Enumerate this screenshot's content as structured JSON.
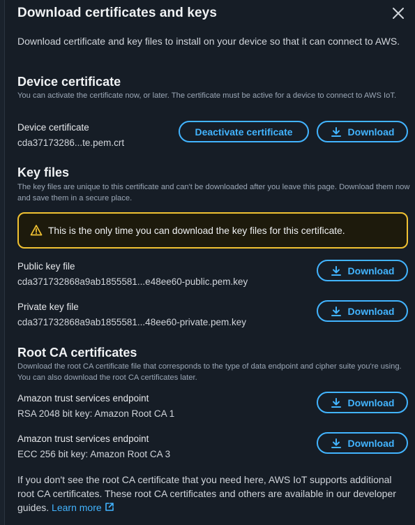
{
  "modal": {
    "title": "Download certificates and keys",
    "close_icon": "close-icon",
    "intro": "Download certificate and key files to install on your device so that it can connect to AWS."
  },
  "device_certificate": {
    "title": "Device certificate",
    "description": "You can activate the certificate now, or later. The certificate must be active for a device to connect to AWS IoT.",
    "label": "Device certificate",
    "value": "cda37173286...te.pem.crt",
    "deactivate_label": "Deactivate certificate",
    "download_label": "Download"
  },
  "key_files": {
    "title": "Key files",
    "description": "The key files are unique to this certificate and can't be downloaded after you leave this page. Download them now and save them in a secure place.",
    "alert": "This is the only time you can download the key files for this certificate.",
    "alert_icon": "warning-icon",
    "public_label": "Public key file",
    "public_value": "cda371732868a9ab1855581...e48ee60-public.pem.key",
    "private_label": "Private key file",
    "private_value": "cda371732868a9ab1855581...48ee60-private.pem.key",
    "download_label": "Download"
  },
  "root_ca": {
    "title": "Root CA certificates",
    "description": "Download the root CA certificate file that corresponds to the type of data endpoint and cipher suite you're using. You can also download the root CA certificates later.",
    "rsa_label": "Amazon trust services endpoint",
    "rsa_value": "RSA 2048 bit key: Amazon Root CA 1",
    "ecc_label": "Amazon trust services endpoint",
    "ecc_value": "ECC 256 bit key: Amazon Root CA 3",
    "download_label": "Download"
  },
  "footer": {
    "text": "If you don't see the root CA certificate that you need here, AWS IoT supports additional root CA certificates. These root CA certificates and others are available in our developer guides. ",
    "learn_more": "Learn more",
    "external_icon": "external-link-icon"
  },
  "colors": {
    "accent": "#42b4ff",
    "warning": "#f1c232",
    "background": "#161d26"
  }
}
